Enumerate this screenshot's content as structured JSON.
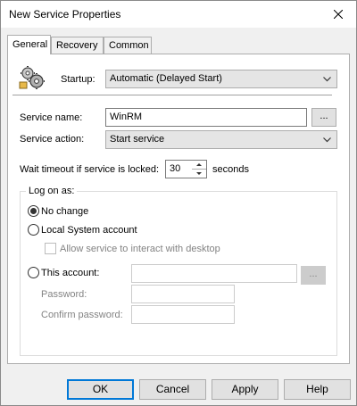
{
  "window": {
    "title": "New Service Properties"
  },
  "tabs": [
    {
      "label": "General"
    },
    {
      "label": "Recovery"
    },
    {
      "label": "Common"
    }
  ],
  "general": {
    "startup_label": "Startup:",
    "startup_value": "Automatic (Delayed Start)",
    "service_name_label": "Service name:",
    "service_name_value": "WinRM",
    "browse_label": "...",
    "service_action_label": "Service action:",
    "service_action_value": "Start service",
    "wait_timeout_label": "Wait timeout if service is locked:",
    "wait_timeout_value": "30",
    "wait_timeout_unit": "seconds"
  },
  "logon": {
    "group_label": "Log on as:",
    "no_change_label": "No change",
    "local_system_label": "Local System account",
    "interact_label": "Allow service to interact with desktop",
    "this_account_label": "This account:",
    "account_browse_label": "...",
    "password_label": "Password:",
    "confirm_password_label": "Confirm password:",
    "selected": "No change"
  },
  "buttons": {
    "ok": "OK",
    "cancel": "Cancel",
    "apply": "Apply",
    "help": "Help"
  },
  "colors": {
    "accent": "#0078d7"
  }
}
